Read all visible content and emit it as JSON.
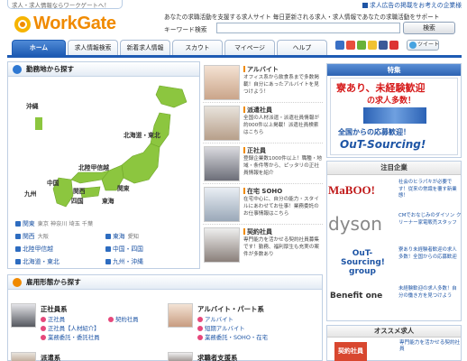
{
  "header": {
    "tagline": "求人・求人情報ならワークゲートへ！",
    "ad_link": "求人広告の掲載をお考えの企業様",
    "logo_text": "WorkGate",
    "description": "あなたの求職活動を支援する求人サイト 毎日更新される求人・求人情報であなたの求職活動をサポート",
    "keyword_label": "キーワード検索",
    "keyword_value": "",
    "search_button": "検索",
    "tweet_label": "ツイート"
  },
  "nav": {
    "tabs": [
      "ホーム",
      "求人情報検索",
      "新着求人情報",
      "スカウト",
      "マイページ",
      "ヘルプ"
    ]
  },
  "area": {
    "title": "勤務地から探す",
    "map_labels": [
      "沖縄",
      "北海道・東北",
      "北陸甲信越",
      "関東",
      "中国",
      "四国",
      "関西",
      "九州",
      "東海"
    ],
    "links": [
      {
        "label": "関東",
        "sub": "東京 神奈川 埼玉 千葉"
      },
      {
        "label": "関西",
        "sub": "大阪"
      },
      {
        "label": "東海",
        "sub": "愛知"
      },
      {
        "label": "北陸甲信越",
        "sub": ""
      },
      {
        "label": "中国・四国",
        "sub": ""
      },
      {
        "label": "北海道・東北",
        "sub": ""
      },
      {
        "label": "九州・沖縄",
        "sub": ""
      }
    ]
  },
  "features": [
    {
      "title": "アルバイト",
      "desc": "オフィス系から飲食系まで多数掲載！自分にあったアルバイトを見つけよう！"
    },
    {
      "title": "派遣社員",
      "desc": "全国の人材派遣・派遣社員情報が約000件以上掲載！派遣社員検索はこちら"
    },
    {
      "title": "正社員",
      "desc": "登録企業数1000件以上！職種・地域・条件等から、ピッタリの正社員情報を紹介"
    },
    {
      "title": "在宅 SOHO",
      "desc": "在宅中心に、自分の能力・スタイルにあわせてお仕事！業務委託のお仕事情報はこちら"
    },
    {
      "title": "契約社員",
      "desc": "専門能力を活かせる契約社員募集です！勤務、福利厚生も充実の案件が多数あり"
    }
  ],
  "special": {
    "title": "特集",
    "headline": "寮あり、未経験歓迎",
    "headline_sub": "の求人多数！",
    "banner_top": "全国からの応募歓迎！",
    "banner_main": "OuT-Sourcing!"
  },
  "companies": {
    "title": "注目企業",
    "items": [
      {
        "name": "MaBOO!",
        "text": "社会のヒラパキが必要です！従来の常識を覆す新業態！"
      },
      {
        "name": "dyson",
        "text": "CMでおなじみのダイソン クリーナー家電販売スタッフ"
      },
      {
        "name": "OuT-Sourcing! group",
        "text": "寮あり未経験者歓迎の求人多数！全国からの応募歓迎"
      },
      {
        "name": "Benefit one",
        "text": "未経験歓迎の求人多数！自分の働き方を見つけよう"
      }
    ]
  },
  "osusume": {
    "title": "オススメ求人",
    "badge": "契約社員",
    "text": "専門能力を活かせる契約社員"
  },
  "employment": {
    "title": "雇用形態から探す",
    "groups": [
      {
        "title": "正社員系",
        "links": [
          "正社員",
          "契約社員",
          "正社員【人材紹介】",
          "業務委託・委託社員"
        ]
      },
      {
        "title": "アルバイト・パート系",
        "links": [
          "アルバイト",
          "短期アルバイト",
          "業務委託・SOHO・在宅"
        ]
      },
      {
        "title": "派遣系",
        "links": []
      },
      {
        "title": "求職者支援系",
        "links": []
      }
    ]
  },
  "colors": {
    "brand_orange": "#f08a00",
    "nav_blue": "#1e5bb3",
    "link_blue": "#1e55a5",
    "special_red": "#d61a1a",
    "map_green": "#8cc63f"
  }
}
